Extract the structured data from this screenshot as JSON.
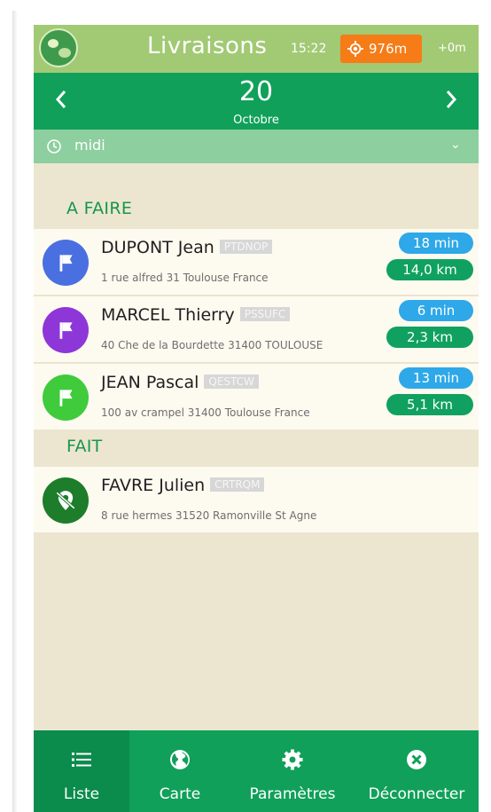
{
  "header": {
    "title": "Livraisons",
    "time": "15:22",
    "gps": "976m",
    "offset": "+0m"
  },
  "date": {
    "day": "20",
    "month": "Octobre",
    "prev_icon": "chevron-left-icon",
    "next_icon": "chevron-right-icon"
  },
  "time_slot": {
    "label": "midi",
    "icon": "clock-icon"
  },
  "sections": {
    "todo": "A FAIRE",
    "done": "FAIT"
  },
  "todo_items": [
    {
      "name": "DUPONT Jean",
      "code": "PTDNOP",
      "address": "1 rue alfred 31 Toulouse France",
      "duration": "18 min",
      "distance": "14,0 km",
      "color": "#4a6fe0",
      "icon": "flag-icon"
    },
    {
      "name": "MARCEL Thierry",
      "code": "PSSUFC",
      "address": "40 Che de la Bourdette 31400 TOULOUSE",
      "duration": "6 min",
      "distance": "2,3 km",
      "color": "#8e37d8",
      "icon": "flag-icon"
    },
    {
      "name": "JEAN Pascal",
      "code": "QESTCW",
      "address": "100 av crampel 31400 Toulouse France",
      "duration": "13 min",
      "distance": "5,1 km",
      "color": "#3fcb3c",
      "icon": "flag-icon"
    }
  ],
  "done_items": [
    {
      "name": "FAVRE Julien",
      "code": "CRTRQM",
      "address": "8 rue hermes 31520 Ramonville St Agne",
      "color": "#1d7d2a",
      "icon": "delivered-pin-icon"
    }
  ],
  "tabs": [
    {
      "label": "Liste",
      "icon": "list-icon",
      "active": true
    },
    {
      "label": "Carte",
      "icon": "globe-icon",
      "active": false
    },
    {
      "label": "Paramètres",
      "icon": "gear-icon",
      "active": false
    },
    {
      "label": "Déconnecter",
      "icon": "close-circle-icon",
      "active": false
    }
  ],
  "colors": {
    "header": "#a2c974",
    "primary": "#11a05a",
    "time_bar": "#8dcf9f",
    "gps_badge": "#f57c17",
    "duration_pill": "#2ea8e8",
    "distance_pill": "#10a160"
  }
}
